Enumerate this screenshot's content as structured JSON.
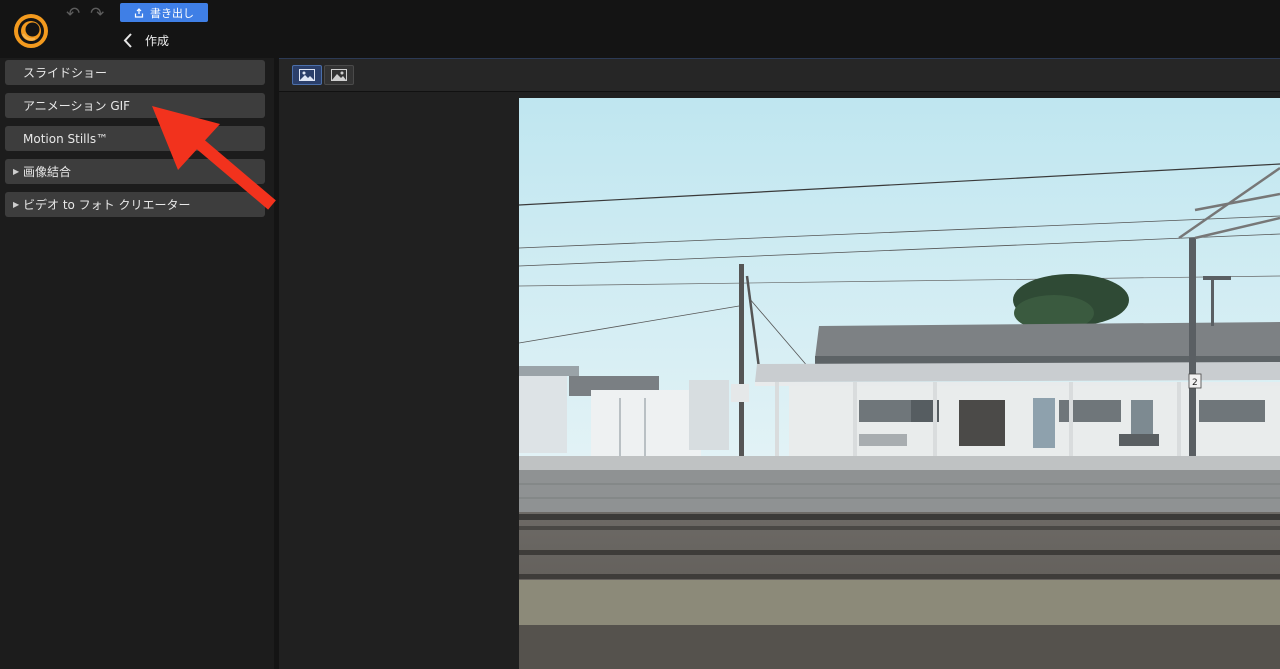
{
  "header": {
    "export_label": "書き出し",
    "back_title": "作成"
  },
  "sidebar": {
    "items": [
      {
        "label": "スライドショー",
        "expandable": false
      },
      {
        "label": "アニメーション GIF",
        "expandable": false
      },
      {
        "label": "Motion Stills™",
        "expandable": false
      },
      {
        "label": "画像結合",
        "expandable": true
      },
      {
        "label": "ビデオ to フォト クリエーター",
        "expandable": true
      }
    ]
  },
  "preview": {
    "view_modes": [
      "single-image-icon",
      "image-icon"
    ],
    "active_view": 0
  },
  "photo_signs": {
    "track_number": "2"
  },
  "colors": {
    "accent": "#3f7fe6",
    "logo_orange": "#f39a1e",
    "annotation_arrow": "#f2321d"
  }
}
